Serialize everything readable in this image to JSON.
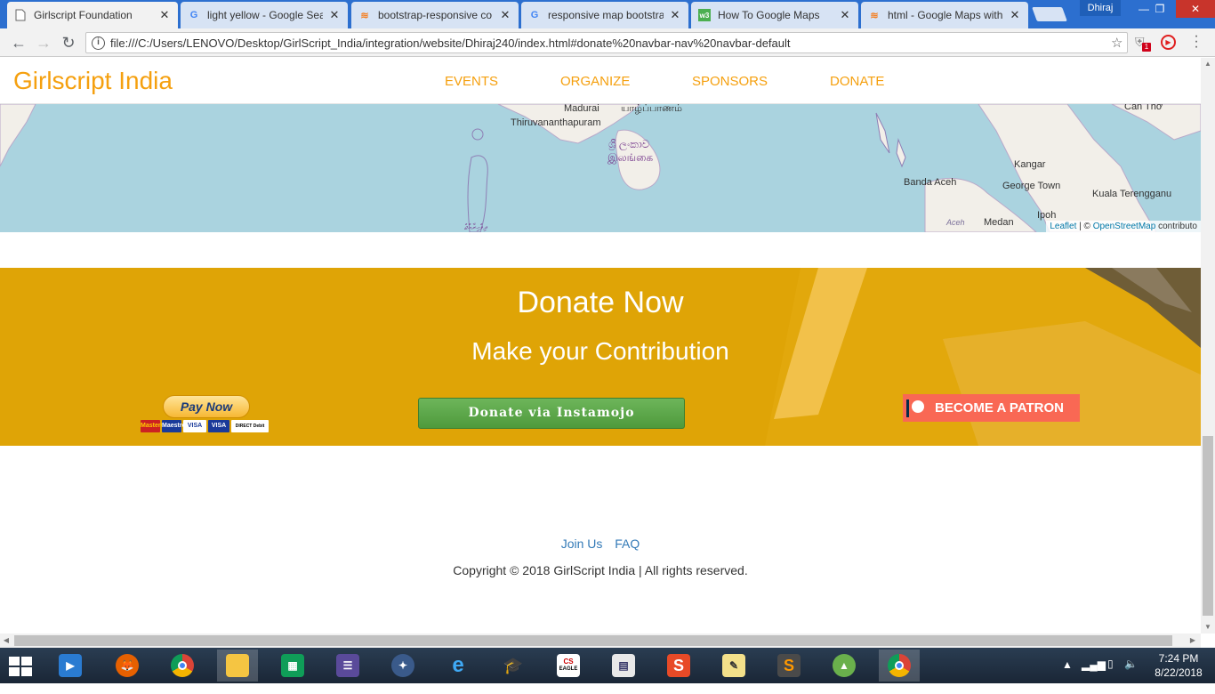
{
  "browser": {
    "tabs": [
      {
        "title": "Girlscript Foundation",
        "icon": "page-icon",
        "active": true
      },
      {
        "title": "light yellow - Google Sea",
        "icon": "google-icon"
      },
      {
        "title": "bootstrap-responsive co",
        "icon": "stackoverflow-icon"
      },
      {
        "title": "responsive map bootstra",
        "icon": "google-icon"
      },
      {
        "title": "How To Google Maps",
        "icon": "w3schools-icon"
      },
      {
        "title": "html - Google Maps with",
        "icon": "stackoverflow-icon"
      }
    ],
    "profile_name": "Dhiraj",
    "url": "file:///C:/Users/LENOVO/Desktop/GirlScript_India/integration/website/Dhiraj240/index.html#donate%20navbar-nav%20navbar-default",
    "extension_badge": "1"
  },
  "site": {
    "brand": "Girlscript India",
    "nav": [
      "EVENTS",
      "ORGANIZE",
      "SPONSORS",
      "DONATE"
    ],
    "brand_color": "#f5a00f"
  },
  "map": {
    "labels": {
      "madurai": "Madurai",
      "tamil_city": "யாழ்ப்பாணம்",
      "thiruvananthapuram": "Thiruvananthapuram",
      "srilanka_sinhala": "ශ්‍රී ලංකාව",
      "srilanka_tamil": "இலங்கை",
      "maldives": "ދިވެހިރާއްޖެ",
      "can_tho": "Can Thơ",
      "kangar": "Kangar",
      "banda_aceh": "Banda Aceh",
      "george_town": "George Town",
      "kuala_terengganu": "Kuala Terengganu",
      "aceh": "Aceh",
      "medan": "Medan",
      "ipoh": "Ipoh"
    },
    "attribution": {
      "leaflet": "Leaflet",
      "separator": " | © ",
      "osm": "OpenStreetMap",
      "suffix": " contributo"
    },
    "water_color": "#aad3df"
  },
  "donate": {
    "title": "Donate Now",
    "subtitle": "Make your Contribution",
    "paypal_button": "Pay Now",
    "cards": [
      "MasterCard",
      "Maestro",
      "VISA",
      "VISA",
      "DIRECT Debit"
    ],
    "instamojo_button": "Donate via Instamojo",
    "patreon_button": "BECOME A PATRON",
    "background_color": "#dfa406"
  },
  "footer": {
    "links": [
      "Join Us",
      "FAQ"
    ],
    "copyright": "Copyright © 2018 GirlScript India | All rights reserved."
  },
  "taskbar": {
    "apps": [
      "windows-media-icon",
      "firefox-icon",
      "chrome-icon",
      "file-explorer-icon",
      "store-icon",
      "app-icon",
      "network-icon",
      "internet-explorer-icon",
      "graduation-icon",
      "cs-eagle-icon",
      "document-icon",
      "swiftkey-icon",
      "image-icon",
      "sublime-icon",
      "android-studio-icon",
      "chrome-active-icon"
    ],
    "cs_label": "CS",
    "eagle_label": "EAGLE",
    "time": "7:24 PM",
    "date": "8/22/2018"
  }
}
